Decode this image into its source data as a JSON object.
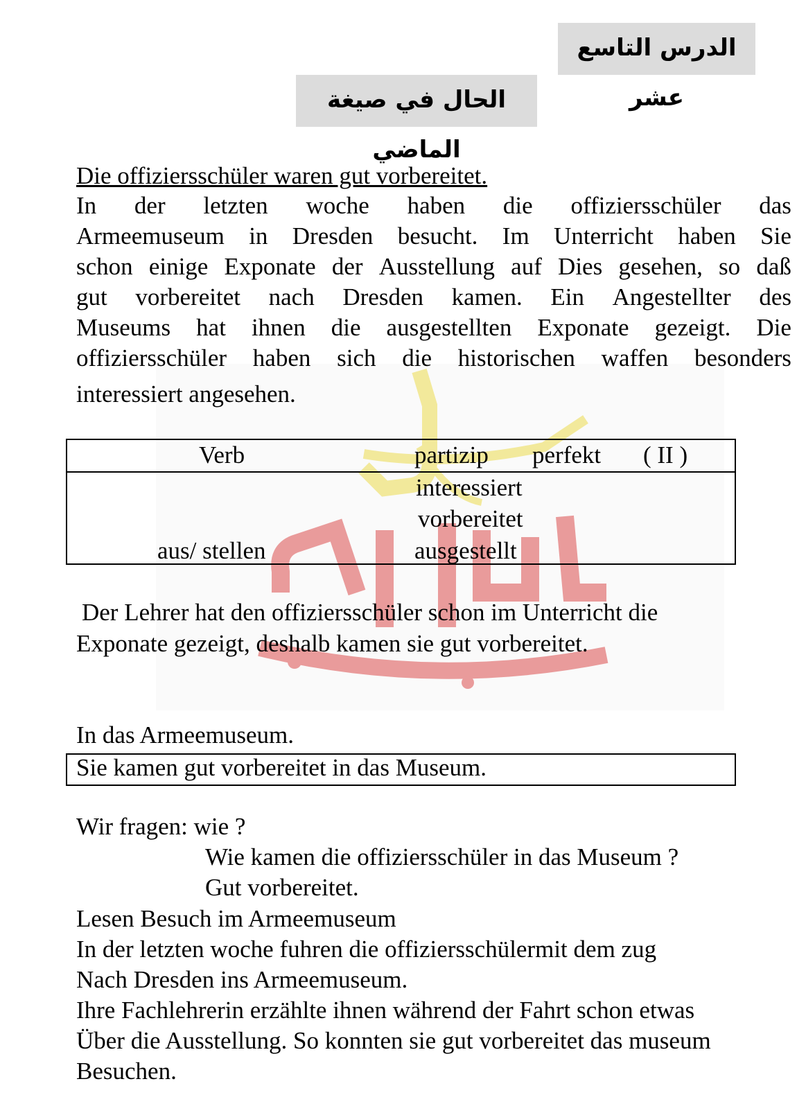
{
  "header": {
    "lesson_title": "الدرس التاسع عشر",
    "topic_title": "الحال في صيغة الماضي"
  },
  "text_title": "Die offiziersschüler waren gut vorbereitet.",
  "paragraph_lines": [
    [
      "In",
      "der",
      "letzten",
      "woche",
      "haben",
      "die",
      "offiziersschüler",
      "das"
    ],
    [
      "Armeemuseum",
      "in",
      "Dresden",
      "besucht.",
      "Im",
      "Unterricht",
      "haben",
      "Sie"
    ],
    [
      "schon",
      "einige",
      "Exponate",
      "der",
      "Ausstellung",
      "auf",
      "Dies",
      "gesehen,",
      "so",
      "daß"
    ],
    [
      "gut",
      "vorbereitet",
      "nach",
      "Dresden",
      "kamen.",
      "Ein",
      "Angestellter",
      "des"
    ],
    [
      "Museums",
      "hat",
      "ihnen",
      "die",
      "ausgestellten",
      "Exponate",
      "gezeigt.",
      "Die"
    ],
    [
      "offiziersschüler",
      "haben",
      "sich",
      "die",
      "historischen",
      "waffen",
      "besonders"
    ]
  ],
  "paragraph_last": "interessiert angesehen.",
  "table": {
    "header_verb": "Verb",
    "header_partizip": "partizip",
    "header_perfekt": "perfekt",
    "header_roman": "( II )",
    "rows": [
      {
        "verb": "",
        "partizip": "interessiert"
      },
      {
        "verb": "",
        "partizip": "vorbereitet"
      },
      {
        "verb": "aus/ stellen",
        "partizip": "ausgestellt"
      }
    ]
  },
  "lehrer_line1": "Der Lehrer hat den offiziersschüler schon im Unterricht die",
  "lehrer_line2": "Exponate gezeigt, deshalb kamen sie gut vorbereitet.",
  "museum_line": "In das Armeemuseum.",
  "boxed_sentence": "Sie kamen gut vorbereitet in das Museum.",
  "question": {
    "prompt": "Wir fragen: wie ?",
    "q": "Wie kamen die offiziersschüler in das Museum ?",
    "a": "Gut vorbereitet."
  },
  "reading": {
    "title": "Lesen Besuch im Armeemuseum",
    "lines": [
      "In der letzten woche fuhren die offiziersschülermit dem zug",
      "Nach Dresden ins Armeemuseum.",
      "Ihre Fachlehrerin erzählte ihnen während der Fahrt schon etwas",
      "Über die Ausstellung. So konnten sie gut vorbereitet das museum",
      "Besuchen."
    ]
  },
  "colors": {
    "watermark_red": "#d84a4a",
    "watermark_yellow": "#e9d84a",
    "title_bg": "#dcdcdc"
  }
}
